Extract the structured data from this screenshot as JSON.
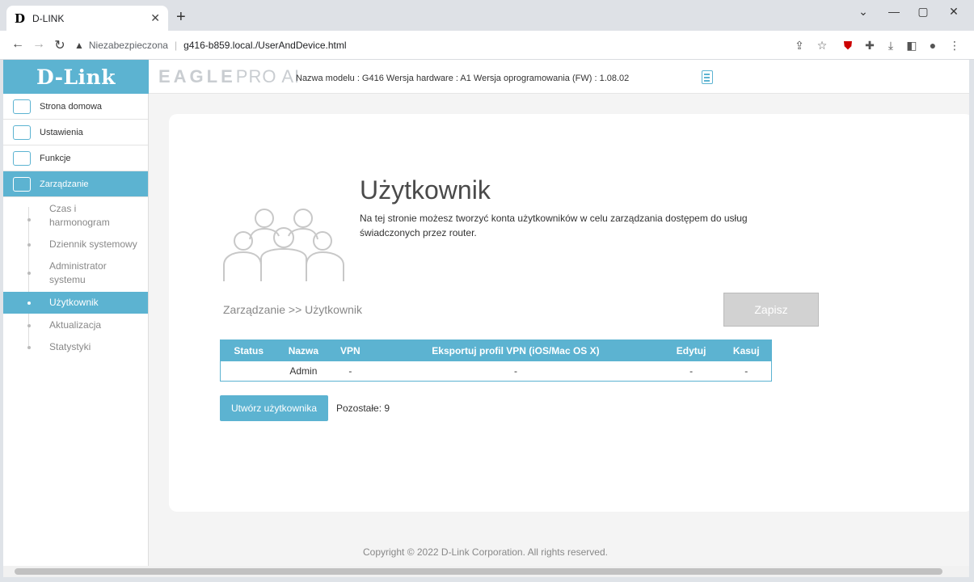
{
  "browser": {
    "tab_title": "D-LINK",
    "tab_favicon": "D",
    "insecure_label": "Niezabezpieczona",
    "url": "g416-b859.local./UserAndDevice.html"
  },
  "header": {
    "logo": "D-Link",
    "brand_main": "EAGLE",
    "brand_sub": "PRO AI",
    "model_info": "Nazwa modelu : G416 Wersja hardware : A1 Wersja oprogramowania (FW) : 1.08.02"
  },
  "sidebar": {
    "items": [
      {
        "label": "Strona domowa",
        "icon": "home-network-icon"
      },
      {
        "label": "Ustawienia",
        "icon": "settings-icon"
      },
      {
        "label": "Funkcje",
        "icon": "features-icon"
      },
      {
        "label": "Zarządzanie",
        "icon": "management-icon"
      }
    ],
    "subitems": [
      "Czas i",
      "harmonogram",
      "Dziennik systemowy",
      "Administrator",
      "systemu",
      "Użytkownik",
      "Aktualizacja",
      "Statystyki"
    ]
  },
  "main": {
    "title": "Użytkownik",
    "description": "Na tej stronie możesz tworzyć konta użytkowników w celu zarządzania dostępem do usług świadczonych przez router.",
    "breadcrumb": "Zarządzanie >> Użytkownik",
    "save_label": "Zapisz",
    "table": {
      "headers": [
        "Status",
        "Nazwa",
        "VPN",
        "Eksportuj profil VPN (iOS/Mac OS X)",
        "Edytuj",
        "Kasuj"
      ],
      "rows": [
        [
          "",
          "Admin",
          "-",
          "-",
          "-",
          "-"
        ]
      ]
    },
    "create_label": "Utwórz użytkownika",
    "remaining": "Pozostałe: 9"
  },
  "footer": "Copyright © 2022 D-Link Corporation. All rights reserved.",
  "colors": {
    "accent": "#5cb3d1",
    "save_disabled": "#d2d2d2"
  }
}
